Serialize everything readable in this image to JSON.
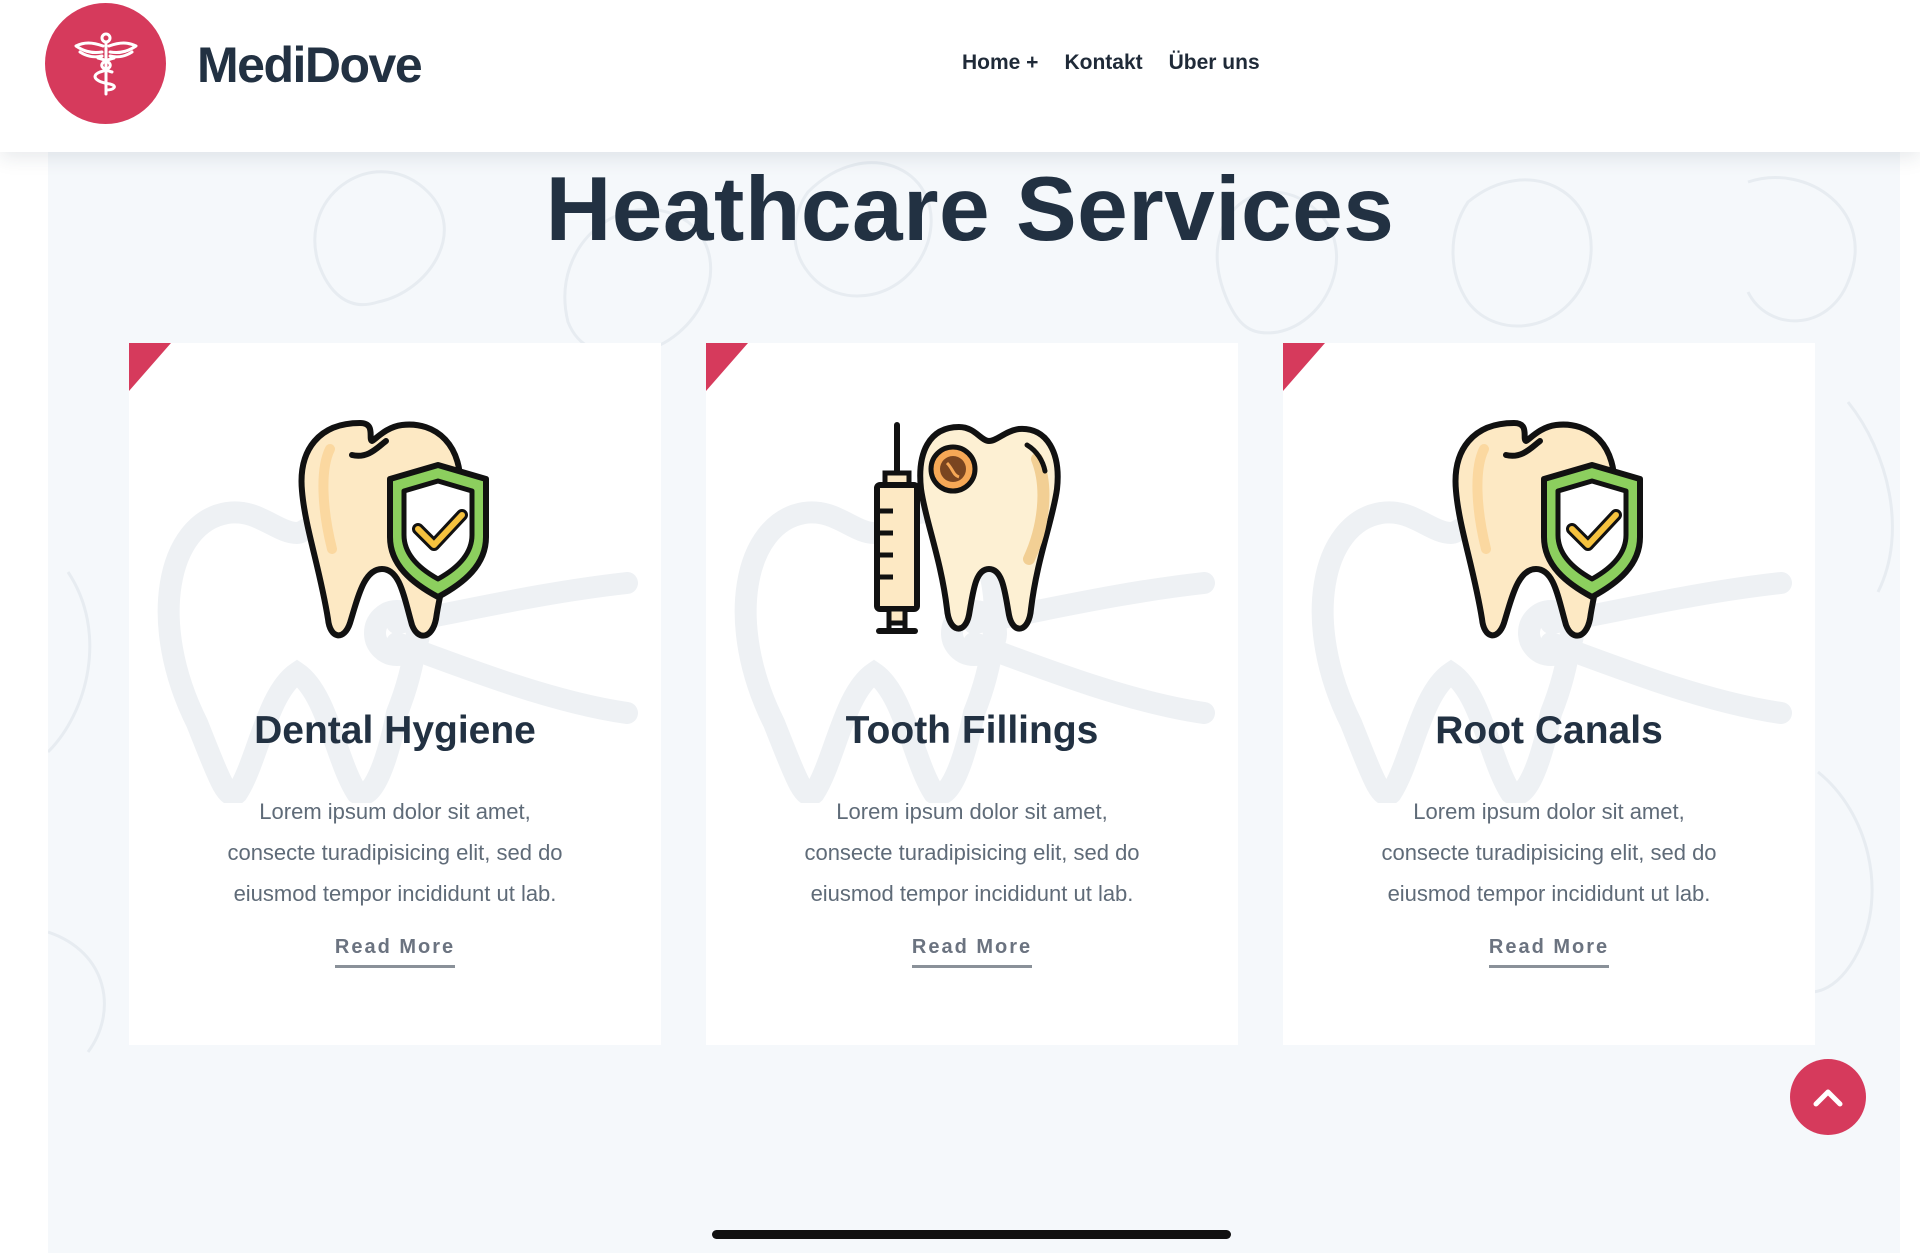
{
  "header": {
    "brand": "MediDove",
    "logo_icon": "caduceus-icon",
    "nav": [
      "Home +",
      "Kontakt",
      "Über uns"
    ]
  },
  "main": {
    "title": "Heathcare Services",
    "cards": [
      {
        "title": "Dental Hygiene",
        "icon": "tooth-shield-icon",
        "lines": [
          "Lorem ipsum dolor sit amet,",
          "consecte turadipisicing elit, sed do",
          "eiusmod tempor incididunt ut lab."
        ],
        "link": "Read More"
      },
      {
        "title": "Tooth Fillings",
        "icon": "tooth-syringe-icon",
        "lines": [
          "Lorem ipsum dolor sit amet,",
          "consecte turadipisicing elit, sed do",
          "eiusmod tempor incididunt ut lab."
        ],
        "link": "Read More"
      },
      {
        "title": "Root Canals",
        "icon": "tooth-shield-icon",
        "lines": [
          "Lorem ipsum dolor sit amet,",
          "consecte turadipisicing elit, sed do",
          "eiusmod tempor incididunt ut lab."
        ],
        "link": "Read More"
      }
    ]
  },
  "scroll_top_icon": "chevron-up-icon",
  "colors": {
    "accent": "#d63a5c",
    "heading": "#223142",
    "body_text": "#5f6b78",
    "section_bg": "#f5f8fb"
  }
}
